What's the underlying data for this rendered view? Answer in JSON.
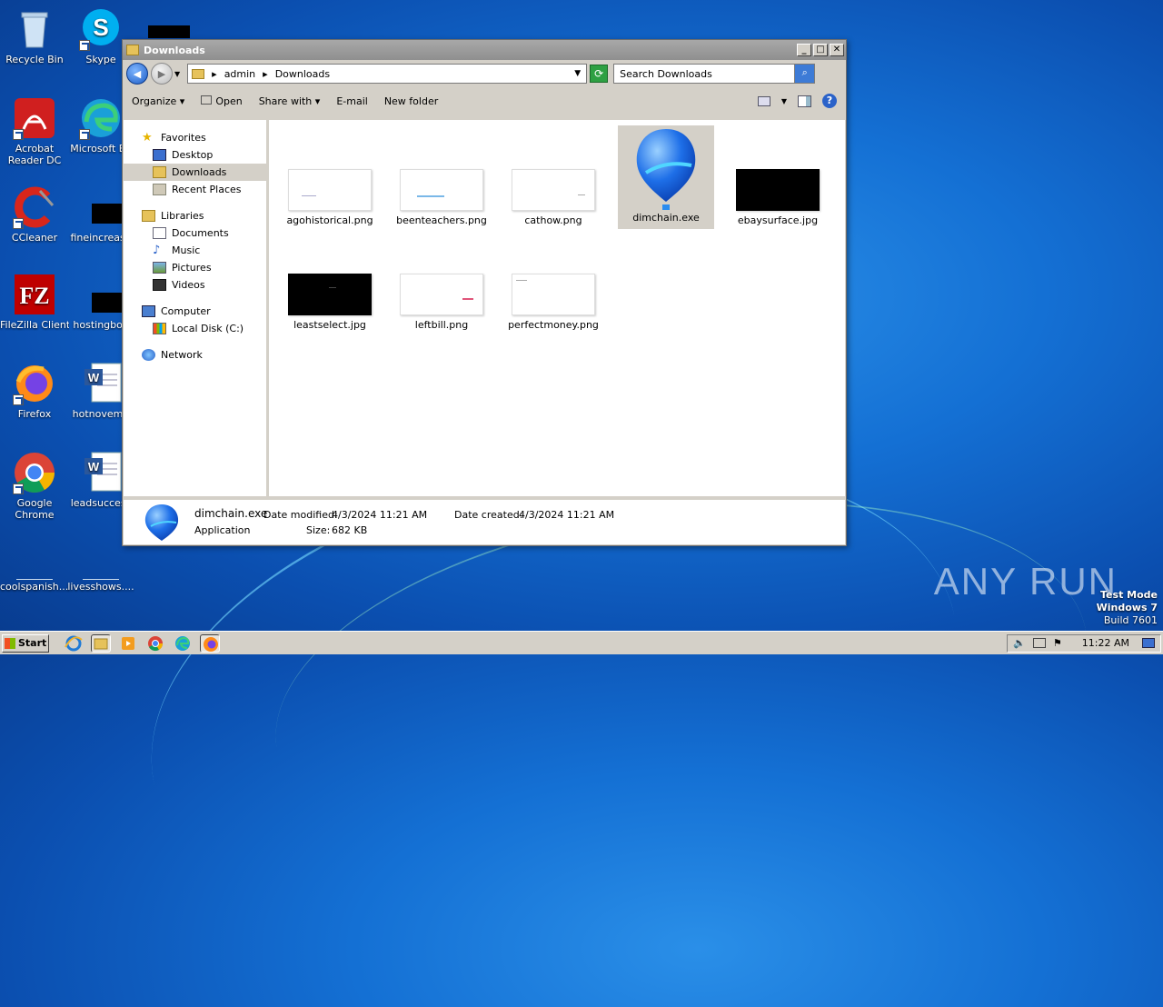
{
  "desktop": {
    "icons": [
      {
        "label": "Recycle Bin",
        "icon": "recycle-bin-icon"
      },
      {
        "label": "Skype",
        "icon": "skype-icon"
      },
      {
        "label": "Acrobat Reader DC",
        "icon": "acrobat-icon"
      },
      {
        "label": "Microsoft Ed",
        "icon": "edge-icon"
      },
      {
        "label": "CCleaner",
        "icon": "ccleaner-icon"
      },
      {
        "label": "fineincrease",
        "icon": "file-icon"
      },
      {
        "label": "FileZilla Client",
        "icon": "filezilla-icon"
      },
      {
        "label": "hostingboa",
        "icon": "file-icon"
      },
      {
        "label": "Firefox",
        "icon": "firefox-icon"
      },
      {
        "label": "hotnovemb",
        "icon": "word-doc-icon"
      },
      {
        "label": "Google Chrome",
        "icon": "chrome-icon"
      },
      {
        "label": "leadsuccess",
        "icon": "word-doc-icon"
      },
      {
        "label": "coolspanish....",
        "icon": "file-icon"
      },
      {
        "label": "livesshows....",
        "icon": "file-icon"
      }
    ]
  },
  "window": {
    "title": "Downloads",
    "address": {
      "crumbs": [
        "admin",
        "Downloads"
      ]
    },
    "search_placeholder": "Search Downloads",
    "toolbar": {
      "organize": "Organize",
      "open": "Open",
      "share_with": "Share with",
      "email": "E-mail",
      "new_folder": "New folder"
    },
    "nav": {
      "favorites": "Favorites",
      "desktop": "Desktop",
      "downloads": "Downloads",
      "recent_places": "Recent Places",
      "libraries": "Libraries",
      "documents": "Documents",
      "music": "Music",
      "pictures": "Pictures",
      "videos": "Videos",
      "computer": "Computer",
      "local_disk": "Local Disk (C:)",
      "network": "Network"
    },
    "files": [
      {
        "name": "agohistorical.png",
        "thumb": "light"
      },
      {
        "name": "beenteachers.png",
        "thumb": "light"
      },
      {
        "name": "cathow.png",
        "thumb": "light"
      },
      {
        "name": "dimchain.exe",
        "thumb": "app",
        "selected": true
      },
      {
        "name": "ebaysurface.jpg",
        "thumb": "dark"
      },
      {
        "name": "leastselect.jpg",
        "thumb": "dark"
      },
      {
        "name": "leftbill.png",
        "thumb": "light"
      },
      {
        "name": "perfectmoney.png",
        "thumb": "light"
      }
    ],
    "details": {
      "name": "dimchain.exe",
      "type": "Application",
      "modified_label": "Date modified:",
      "modified_value": "4/3/2024 11:21 AM",
      "created_label": "Date created:",
      "created_value": "4/3/2024 11:21 AM",
      "size_label": "Size:",
      "size_value": "682 KB"
    }
  },
  "taskbar": {
    "start": "Start",
    "clock": "11:22 AM"
  },
  "watermark": "ANY RUN",
  "testmode": {
    "line1": "Test Mode",
    "line2": "Windows 7",
    "line3": "Build 7601"
  }
}
